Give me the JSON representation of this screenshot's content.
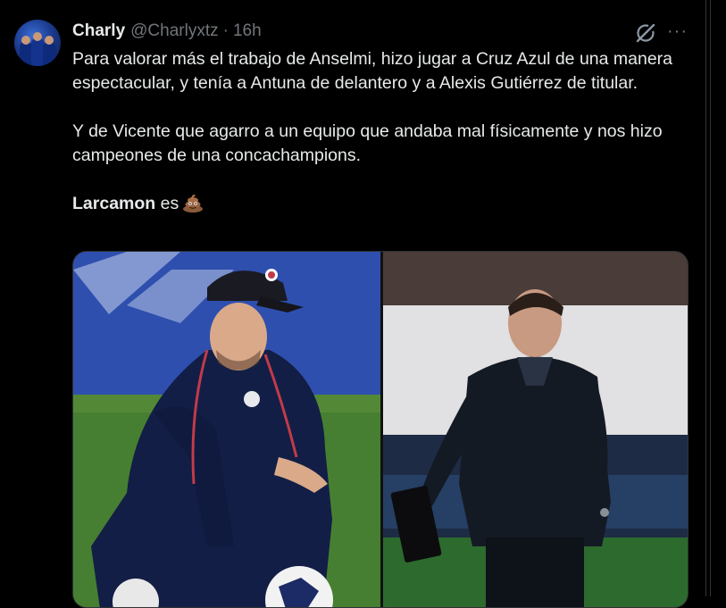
{
  "tweet": {
    "author_name": "Charly",
    "handle": "@Charlyxtz",
    "separator": "·",
    "time": "16h",
    "more_label": "···",
    "paragraph1": "Para valorar más el trabajo de Anselmi, hizo jugar a Cruz Azul de una manera espectacular, y tenía a Antuna de delantero y a Alexis Gutiérrez de titular.",
    "paragraph2": "Y de Vicente que agarro a un equipo que andaba mal físicamente y nos hizo campeones de una concachampions.",
    "paragraph3_bold": "Larcamon",
    "paragraph3_rest": " es",
    "emoji": "pile-of-poo-icon"
  },
  "media": {
    "left_photo": "coach-crouching-photo",
    "right_photo": "coach-walking-photo"
  },
  "colors": {
    "background": "#000000",
    "text": "#e7e9ea",
    "secondary": "#71767b",
    "border": "#2f3336"
  }
}
